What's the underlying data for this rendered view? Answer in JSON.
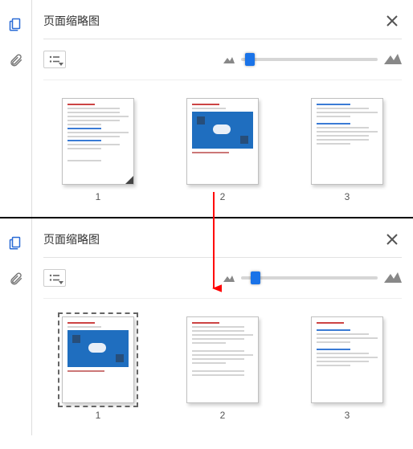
{
  "panels": [
    {
      "title": "页面缩略图",
      "slider_position_pct": 3,
      "pages": [
        {
          "num": "1",
          "selected": false,
          "variant": "text"
        },
        {
          "num": "2",
          "selected": false,
          "variant": "image"
        },
        {
          "num": "3",
          "selected": false,
          "variant": "text-blue"
        }
      ]
    },
    {
      "title": "页面缩略图",
      "slider_position_pct": 7,
      "pages": [
        {
          "num": "1",
          "selected": true,
          "variant": "image-small"
        },
        {
          "num": "2",
          "selected": false,
          "variant": "text-red"
        },
        {
          "num": "3",
          "selected": false,
          "variant": "text-blue"
        }
      ]
    }
  ],
  "arrow": {
    "color": "#ff0000"
  }
}
